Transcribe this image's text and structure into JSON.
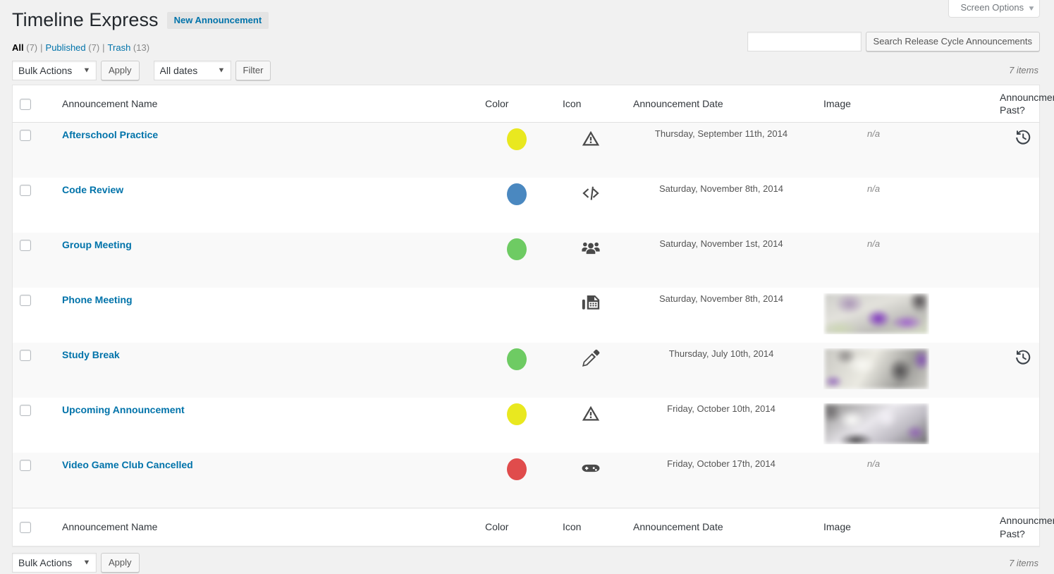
{
  "screen_meta": {
    "screen_options_label": "Screen Options",
    "caret": "▼"
  },
  "header": {
    "title": "Timeline Express",
    "new_button": "New Announcement"
  },
  "status_links": [
    {
      "label": "All",
      "count": "(7)",
      "current": true
    },
    {
      "label": "Published",
      "count": "(7)",
      "current": false
    },
    {
      "label": "Trash",
      "count": "(13)",
      "current": false
    }
  ],
  "separator": "|",
  "search": {
    "value": "",
    "placeholder": "",
    "button_label": "Search Release Cycle Announcements"
  },
  "tablenav_top": {
    "bulk_actions_selected": "Bulk Actions",
    "apply_label": "Apply",
    "dates_selected": "All dates",
    "filter_label": "Filter",
    "displaying_num": "7 items",
    "select_arrow": "▼"
  },
  "tablenav_bottom": {
    "bulk_actions_selected": "Bulk Actions",
    "apply_label": "Apply",
    "displaying_num": "7 items",
    "select_arrow": "▼"
  },
  "table": {
    "columns": {
      "name": "Announcement Name",
      "color": "Color",
      "icon": "Icon",
      "date": "Announcement Date",
      "image": "Image",
      "past": "Announcment Past?"
    },
    "rows": [
      {
        "name": "Afterschool Practice",
        "color": "#e9e81f",
        "color_name": "yellow",
        "icon": "warning-icon",
        "date": "Thursday, September 11th, 2014",
        "image": "n/a",
        "has_image": false,
        "past": true
      },
      {
        "name": "Code Review",
        "color": "#4a88c0",
        "color_name": "blue",
        "icon": "code-icon",
        "date": "Saturday, November 8th, 2014",
        "image": "n/a",
        "has_image": false,
        "past": false
      },
      {
        "name": "Group Meeting",
        "color": "#6ecb63",
        "color_name": "green",
        "icon": "group-icon",
        "date": "Saturday, November 1st, 2014",
        "image": "n/a",
        "has_image": false,
        "past": false
      },
      {
        "name": "Phone Meeting",
        "color": "#dda css55",
        "color_name": "orange",
        "icon": "fax-icon",
        "date": "Saturday, November 8th, 2014",
        "image": "",
        "has_image": true,
        "past": false
      },
      {
        "name": "Study Break",
        "color": "#6ecb63",
        "color_name": "green",
        "icon": "pencil-icon",
        "date": "Thursday, July 10th, 2014",
        "image": "",
        "has_image": true,
        "past": true
      },
      {
        "name": "Upcoming Announcement",
        "color": "#e9e81f",
        "color_name": "yellow",
        "icon": "warning-icon",
        "date": "Friday, October 10th, 2014",
        "image": "",
        "has_image": true,
        "past": false
      },
      {
        "name": "Video Game Club Cancelled",
        "color": "#e04c4c",
        "color_name": "red",
        "icon": "gamepad-icon",
        "date": "Friday, October 17th, 2014",
        "image": "n/a",
        "has_image": false,
        "past": false
      }
    ]
  }
}
